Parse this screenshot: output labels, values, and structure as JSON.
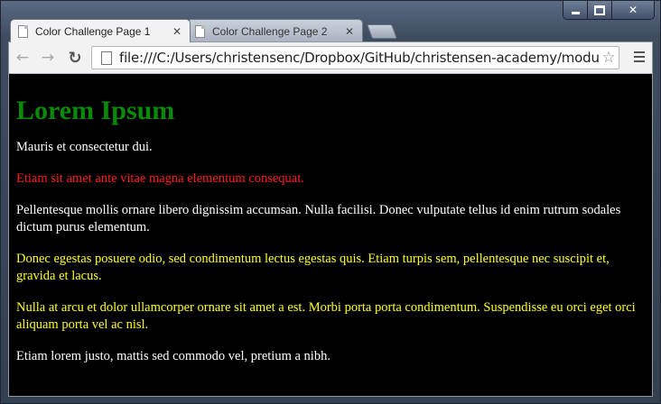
{
  "window": {
    "controls": {
      "minimize": "",
      "maximize": "",
      "close": "✕"
    }
  },
  "tabs": [
    {
      "title": "Color Challenge Page 1",
      "active": true,
      "close": "✕"
    },
    {
      "title": "Color Challenge Page 2",
      "active": false,
      "close": "✕"
    }
  ],
  "toolbar": {
    "back": "←",
    "forward": "→",
    "reload": "↻",
    "url": "file:///C:/Users/christensenc/Dropbox/GitHub/christensen-academy/modules/css",
    "star": "☆"
  },
  "page": {
    "heading": "Lorem Ipsum",
    "paragraphs": [
      {
        "text": "Mauris et consectetur dui.",
        "color": "#ffffff"
      },
      {
        "text": "Etiam sit amet ante vitae magna elementum consequat.",
        "color": "#ff1a1a"
      },
      {
        "text": "Pellentesque mollis ornare libero dignissim accumsan. Nulla facilisi. Donec vulputate tellus id enim rutrum sodales dictum purus elementum.",
        "color": "#ffffff"
      },
      {
        "text": "Donec egestas posuere odio, sed condimentum lectus egestas quis. Etiam turpis sem, pellentesque nec suscipit et, gravida et lacus.",
        "color": "#ffff1a"
      },
      {
        "text": "Nulla at arcu et dolor ullamcorper ornare sit amet a est. Morbi porta porta condimentum. Suspendisse eu orci eget orci aliquam porta vel ac nisl.",
        "color": "#ffff1a"
      },
      {
        "text": "Etiam lorem justo, mattis sed commodo vel, pretium a nibh.",
        "color": "#ffffff"
      }
    ],
    "heading_color": "#0a8a0a",
    "background": "#000000"
  }
}
